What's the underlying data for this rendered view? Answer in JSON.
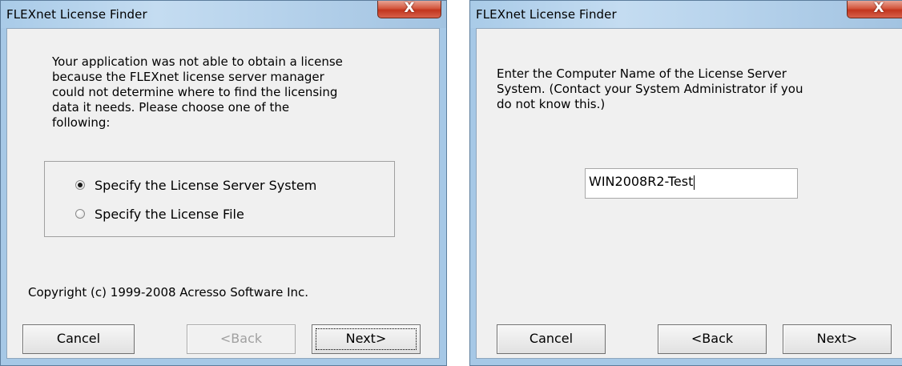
{
  "left_dialog": {
    "title": "FLEXnet License Finder",
    "message": "Your application was not able to obtain a license\nbecause the FLEXnet license server manager\ncould not determine where to find the licensing\ndata it needs.  Please choose one of the\nfollowing:",
    "options": [
      {
        "label": "Specify the License Server System",
        "selected": true
      },
      {
        "label": "Specify the License File",
        "selected": false
      }
    ],
    "copyright": "Copyright (c) 1999-2008 Acresso Software Inc.",
    "buttons": {
      "cancel": "Cancel",
      "back": "<Back",
      "next": "Next>"
    }
  },
  "right_dialog": {
    "title": "FLEXnet License Finder",
    "message": "Enter the Computer Name of the License Server\nSystem.  (Contact your System Administrator if you\ndo not know this.)",
    "server_name_value": "WIN2008R2-Test",
    "buttons": {
      "cancel": "Cancel",
      "back": "<Back",
      "next": "Next>"
    }
  },
  "icons": {
    "close": "close-icon",
    "radio_selected": "radio-selected-icon",
    "radio_unselected": "radio-unselected-icon"
  },
  "colors": {
    "close_button": "#c7432b",
    "frame": "#a6c8e6",
    "client": "#f0f0f0"
  }
}
